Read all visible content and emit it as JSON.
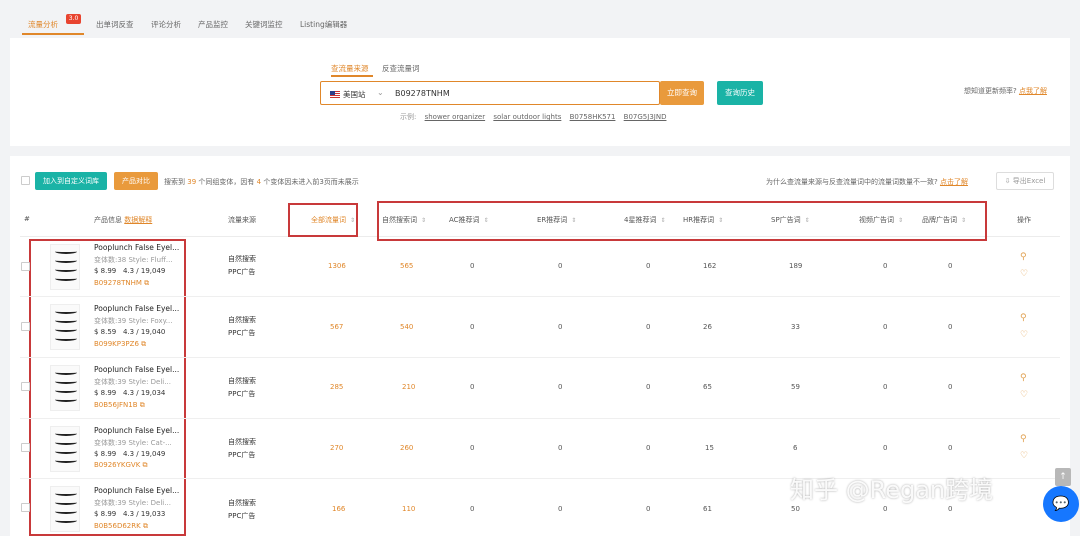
{
  "top_tabs": [
    {
      "label": "流量分析",
      "active": true
    },
    {
      "label": "出单词反查"
    },
    {
      "label": "评论分析"
    },
    {
      "label": "产品监控"
    },
    {
      "label": "关键词监控"
    },
    {
      "label": "Listing编辑器"
    }
  ],
  "version_badge": "3.0",
  "search": {
    "tabs": [
      "查流量来源",
      "反查流量词"
    ],
    "site": "美国站",
    "query": "B09278TNHM",
    "submit_label": "立即查询",
    "history_label": "查询历史",
    "examples_prefix": "示例:",
    "examples": [
      "shower organizer",
      "solar outdoor lights",
      "B0758HK571",
      "B07G5J3JND"
    ],
    "help_text": "想知道更新频率?",
    "help_link": "点我了解"
  },
  "toolbar": {
    "add_label": "加入到自定义词库",
    "compare_label": "产品对比",
    "summary_pre": "搜索到",
    "summary_count": "39",
    "summary_mid": "个同组变体，因有",
    "summary_count2": "4",
    "summary_post": "个变体因未进入前3页而未展示",
    "why_text": "为什么查流量来源与反查流量词中的流量词数量不一致?",
    "why_link": "点击了解",
    "export_label": "导出Excel"
  },
  "table": {
    "headers": {
      "index": "#",
      "product": "产品信息",
      "product_link": "数据解释",
      "source": "流量来源",
      "all_keywords": "全部流量词",
      "natural": "自然搜索词",
      "ac": "AC推荐词",
      "er": "ER推荐词",
      "star4": "4星推荐词",
      "hr": "HR推荐词",
      "sp": "SP广告词",
      "video": "视频广告词",
      "brand": "品牌广告词",
      "action": "操作"
    },
    "rows": [
      {
        "name": "Pooplunch False Eyel...",
        "variant": "变体数:38   Style: Fluff...",
        "price": "$ 8.99",
        "rating": "4.3 / 19,049",
        "asin": "B09278TNHM",
        "src1": "自然搜索",
        "src2": "PPC广告",
        "all": "1306",
        "natural": "565",
        "ac": "0",
        "er": "0",
        "star4": "0",
        "hr": "162",
        "sp": "189",
        "video": "0",
        "brand": "0"
      },
      {
        "name": "Pooplunch False Eyel...",
        "variant": "变体数:39   Style: Foxy...",
        "price": "$ 8.59",
        "rating": "4.3 / 19,040",
        "asin": "B099KP3PZ6",
        "src1": "自然搜索",
        "src2": "PPC广告",
        "all": "567",
        "natural": "540",
        "ac": "0",
        "er": "0",
        "star4": "0",
        "hr": "26",
        "sp": "33",
        "video": "0",
        "brand": "0"
      },
      {
        "name": "Pooplunch False Eyel...",
        "variant": "变体数:39   Style: Deli...",
        "price": "$ 8.99",
        "rating": "4.3 / 19,034",
        "asin": "B0B56JFN1B",
        "src1": "自然搜索",
        "src2": "PPC广告",
        "all": "285",
        "natural": "210",
        "ac": "0",
        "er": "0",
        "star4": "0",
        "hr": "65",
        "sp": "59",
        "video": "0",
        "brand": "0"
      },
      {
        "name": "Pooplunch False Eyel...",
        "variant": "变体数:39   Style: Cat-...",
        "price": "$ 8.99",
        "rating": "4.3 / 19,049",
        "asin": "B0926YKGVK",
        "src1": "自然搜索",
        "src2": "PPC广告",
        "all": "270",
        "natural": "260",
        "ac": "0",
        "er": "0",
        "star4": "0",
        "hr": "15",
        "sp": "6",
        "video": "0",
        "brand": "0"
      },
      {
        "name": "Pooplunch False Eyel...",
        "variant": "变体数:39   Style: Deli...",
        "price": "$ 8.99",
        "rating": "4.3 / 19,033",
        "asin": "B0B56D62RK",
        "src1": "自然搜索",
        "src2": "PPC广告",
        "all": "166",
        "natural": "110",
        "ac": "0",
        "er": "0",
        "star4": "0",
        "hr": "61",
        "sp": "50",
        "video": "0",
        "brand": "0"
      }
    ]
  },
  "watermark": "知乎 @Regan跨境",
  "colors": {
    "accent": "#e0872a",
    "teal": "#1ab3a6",
    "highlight_box": "#c8393a",
    "chat": "#1677ff"
  }
}
